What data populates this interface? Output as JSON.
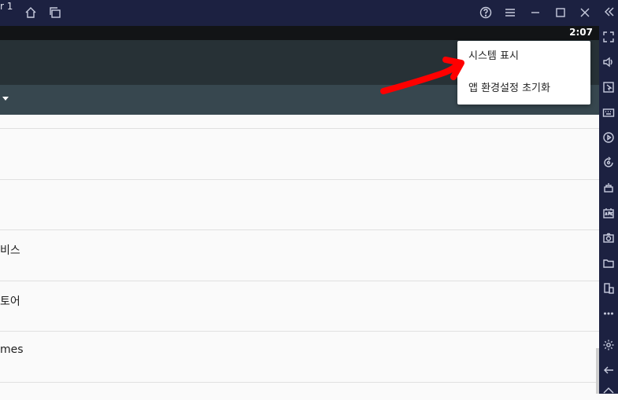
{
  "window": {
    "title": "r 1",
    "controls": [
      "home-icon",
      "multi-instance-icon",
      "help-icon",
      "menu-icon",
      "minimize-icon",
      "maximize-icon",
      "close-icon",
      "collapse-sidebar-icon"
    ]
  },
  "statusbar": {
    "time": "2:07"
  },
  "list": {
    "rows": [
      {
        "label": ""
      },
      {
        "label": ""
      },
      {
        "label": "비스"
      },
      {
        "label": "토어"
      },
      {
        "label": "mes"
      },
      {
        "label": ""
      }
    ]
  },
  "popup_menu": {
    "items": [
      {
        "label": "시스템 표시"
      },
      {
        "label": "앱 환경설정 초기화"
      }
    ]
  },
  "sidebar": {
    "buttons": [
      "fullscreen-icon",
      "volume-icon",
      "pointer-icon",
      "keyboard-icon",
      "macro-play-icon",
      "rotate-icon",
      "shake-icon",
      "apk-icon",
      "screenshot-icon",
      "folder-icon",
      "multi-device-icon",
      "more-icon",
      "settings-icon",
      "back-icon",
      "home-icon"
    ]
  },
  "colors": {
    "titlebar": "#1c2141",
    "appbar": "#273136",
    "subbar": "#37474f",
    "annotation_arrow": "#ff0000"
  }
}
